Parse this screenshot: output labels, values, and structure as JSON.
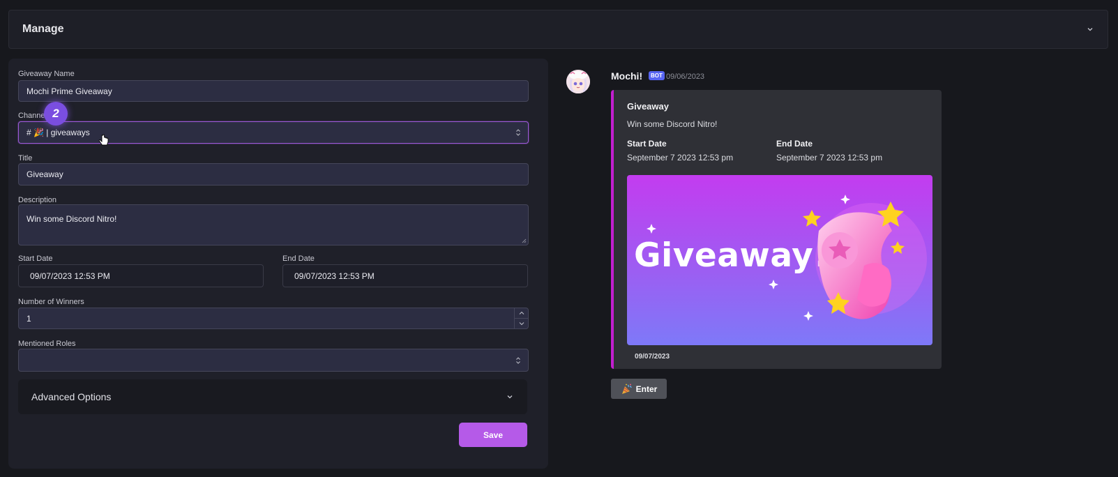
{
  "header": {
    "title": "Manage"
  },
  "form": {
    "name_label": "Giveaway Name",
    "name_value": "Mochi Prime Giveaway",
    "channel_label": "Channel",
    "channel_value": "# 🎉 | giveaways",
    "step_badge": "2",
    "title_label": "Title",
    "title_value": "Giveaway",
    "description_label": "Description",
    "description_value": "Win some Discord Nitro!",
    "start_label": "Start Date",
    "start_value": "09/07/2023 12:53 PM",
    "end_label": "End Date",
    "end_value": "09/07/2023 12:53 PM",
    "winners_label": "Number of Winners",
    "winners_value": "1",
    "roles_label": "Mentioned Roles",
    "roles_value": "",
    "advanced_label": "Advanced Options",
    "save_label": "Save"
  },
  "preview": {
    "bot_name": "Mochi!",
    "bot_tag": "BOT",
    "post_date": "09/06/2023",
    "embed_title": "Giveaway",
    "embed_desc": "Win some Discord Nitro!",
    "start_label": "Start Date",
    "start_value": "September 7 2023 12:53 pm",
    "end_label": "End Date",
    "end_value": "September 7 2023 12:53 pm",
    "image_text": "Giveaway!",
    "footer_date": "09/07/2023",
    "enter_label": "Enter",
    "accent_color": "#c21fcf"
  }
}
